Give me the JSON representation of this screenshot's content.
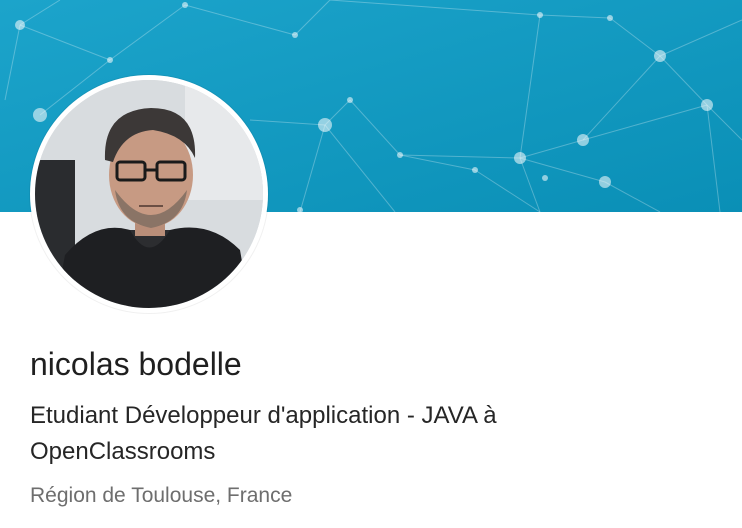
{
  "profile": {
    "name": "nicolas bodelle",
    "headline": "Etudiant Développeur d'application - JAVA à OpenClassrooms",
    "location": "Région de Toulouse, France"
  },
  "banner": {
    "gradient_start": "#1ba0c8",
    "gradient_end": "#0b91b7",
    "pattern": "network-nodes"
  },
  "avatar": {
    "ring_color": "#ffffff"
  }
}
